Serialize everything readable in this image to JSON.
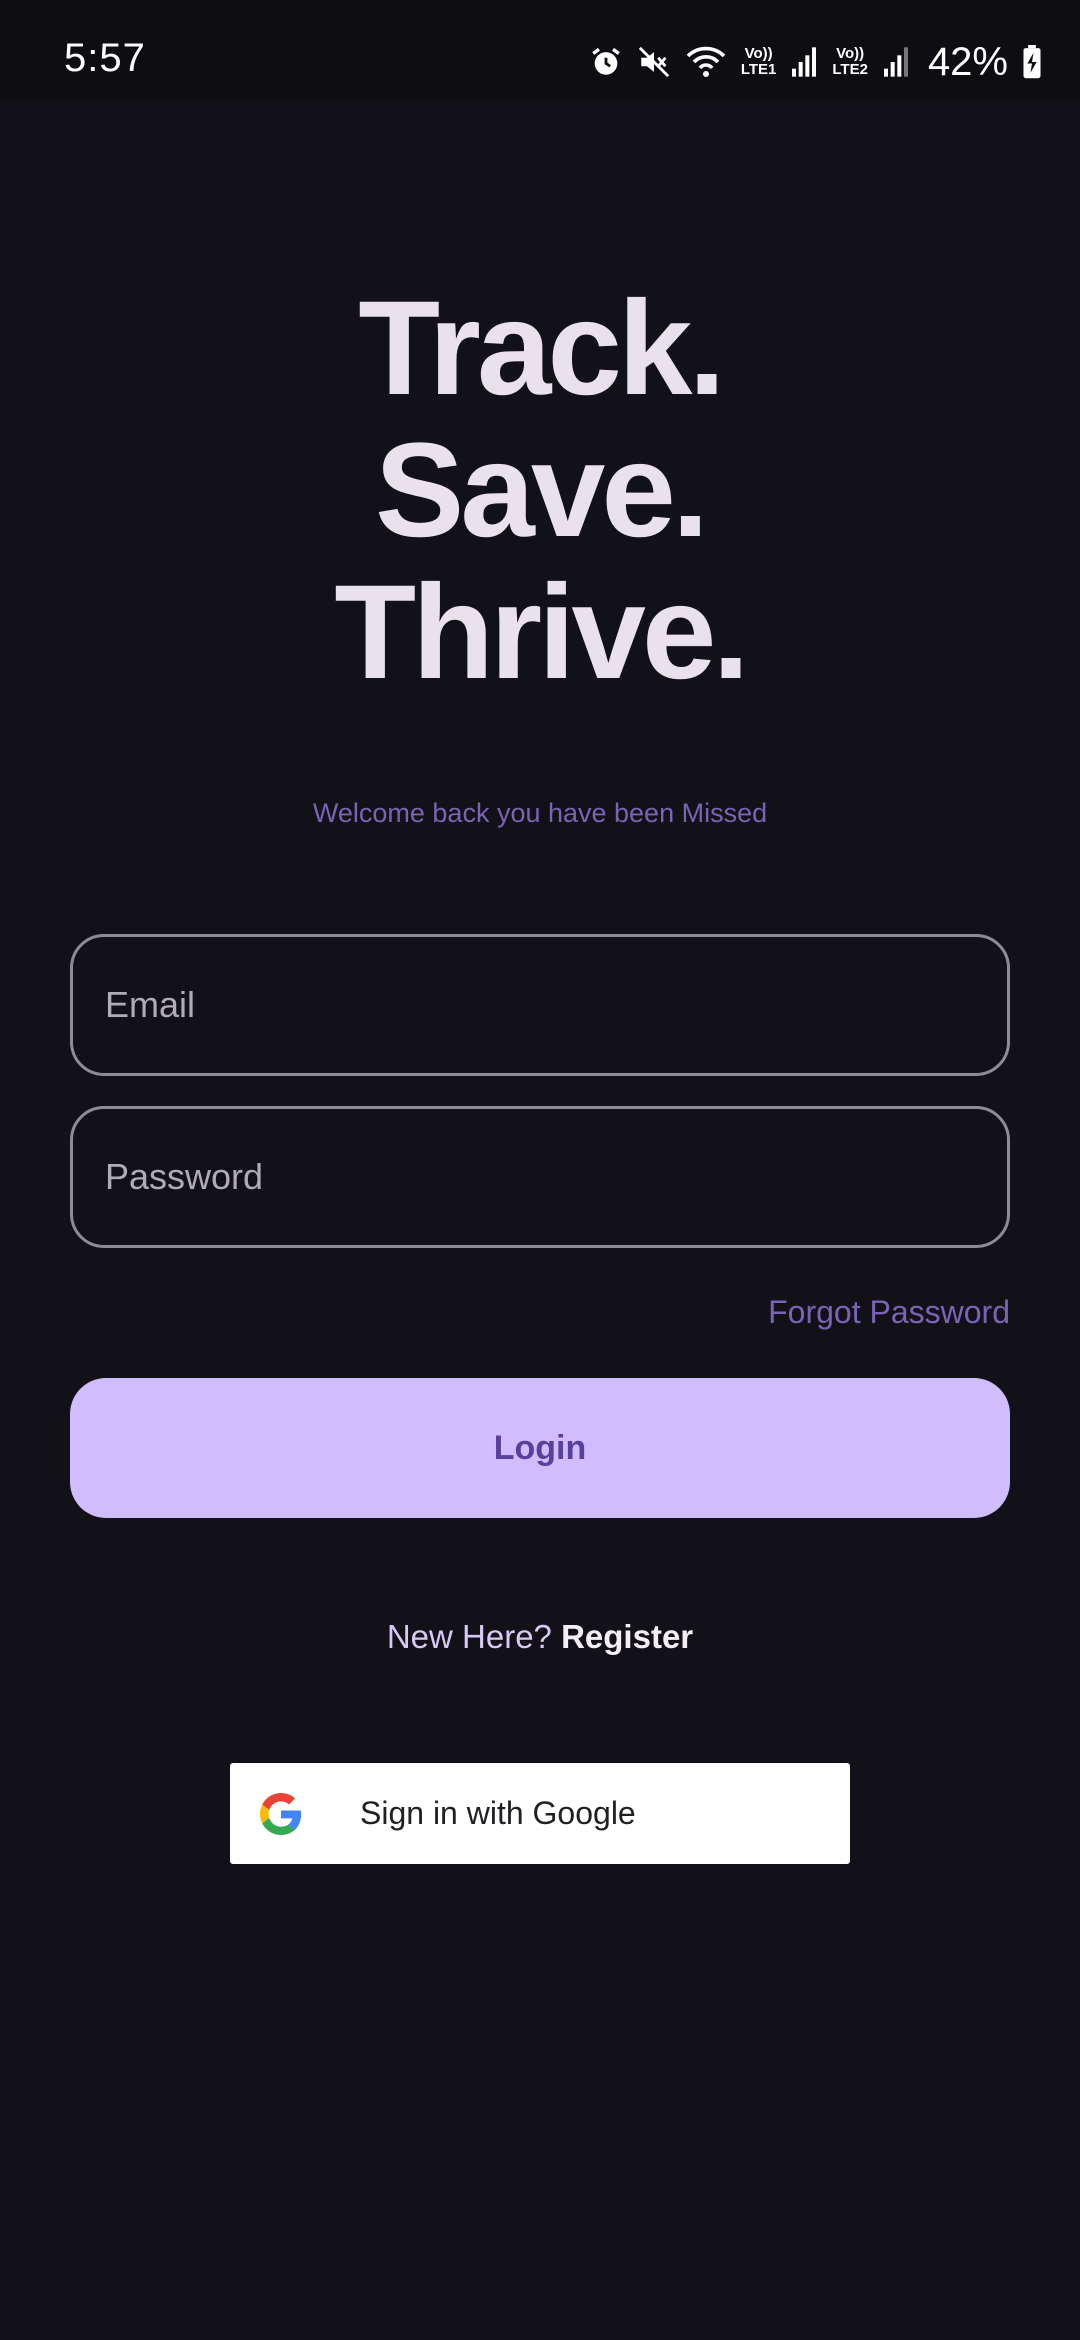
{
  "status_bar": {
    "time": "5:57",
    "icons": [
      "alarm-icon",
      "mute-icon",
      "wifi-icon",
      "signal-sim1-icon",
      "signal-sim2-icon",
      "battery-charging-icon"
    ],
    "sim1_label_top": "Vo))",
    "sim1_label_bottom": "LTE1",
    "sim2_label_top": "Vo))",
    "sim2_label_bottom": "LTE2",
    "battery": "42%"
  },
  "hero": {
    "line1": "Track.",
    "line2": "Save.",
    "line3": "Thrive."
  },
  "subtitle": "Welcome back you have been Missed",
  "form": {
    "email_placeholder": "Email",
    "email_value": "",
    "password_placeholder": "Password",
    "password_value": "",
    "forgot_label": "Forgot Password",
    "login_label": "Login"
  },
  "register": {
    "prompt": "New Here?",
    "link": "Register"
  },
  "google": {
    "label": "Sign in with Google",
    "icon": "google-logo-icon"
  },
  "colors": {
    "background": "#131118",
    "accent": "#d1bcfd",
    "accent_text": "#5a3f9b",
    "muted_purple": "#7a62b5",
    "hero_text": "#e9e1ee"
  }
}
